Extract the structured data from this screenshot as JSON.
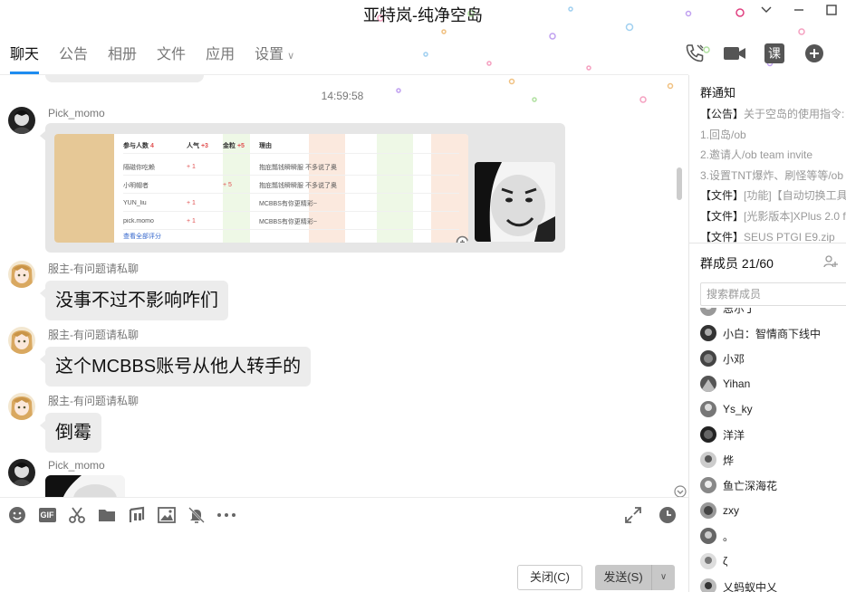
{
  "window": {
    "title": "亚特岚-纯净空岛",
    "controls": [
      "minimize-chevron",
      "minimize",
      "maximize"
    ]
  },
  "tabs": [
    {
      "label": "聊天",
      "active": true
    },
    {
      "label": "公告",
      "active": false
    },
    {
      "label": "相册",
      "active": false
    },
    {
      "label": "文件",
      "active": false
    },
    {
      "label": "应用",
      "active": false
    },
    {
      "label": "设置",
      "active": false
    }
  ],
  "header_tools": {
    "course_label": "课",
    "icons": [
      "phone-icon",
      "video-icon",
      "course-icon",
      "add-circle-icon"
    ]
  },
  "chat": {
    "timestamp": "14:59:58",
    "messages": [
      {
        "sender": "Pick_momo",
        "type": "image",
        "avatar": "dark"
      },
      {
        "sender": "服主-有问题请私聊",
        "type": "text",
        "text": "没事不过不影响咋们",
        "avatar": "anime"
      },
      {
        "sender": "服主-有问题请私聊",
        "type": "text",
        "text": "这个MCBBS账号从他人转手的",
        "avatar": "anime"
      },
      {
        "sender": "服主-有问题请私聊",
        "type": "text",
        "text": "倒霉",
        "avatar": "anime"
      },
      {
        "sender": "Pick_momo",
        "type": "image",
        "avatar": "dark"
      }
    ],
    "rating_table": {
      "headers": {
        "participants": "参与人数",
        "participants_count": "4",
        "popularity": "人气",
        "popularity_delta": "+3",
        "gold": "金粒",
        "gold_delta": "+5",
        "reason": "理由"
      },
      "rows": [
        {
          "user": "隔磁你吃赖",
          "pop": "+ 1",
          "gold": "",
          "reason": "抱庇瓢钱瞬瞬服 不多说了奥"
        },
        {
          "user": "小明帽者",
          "pop": "",
          "gold": "+ 5",
          "reason": "抱庇瓢钱瞬瞬服 不多说了奥"
        },
        {
          "user": "YUN_liu",
          "pop": "+ 1",
          "gold": "",
          "reason": "MCBBS有你更精彩~"
        },
        {
          "user": "pick.momo",
          "pop": "+ 1",
          "gold": "",
          "reason": "MCBBS有你更精彩~"
        }
      ],
      "view_all": "查看全部评分"
    }
  },
  "composer": {
    "tool_icons": [
      "emoji-icon",
      "gif-icon",
      "scissors-icon",
      "folder-icon",
      "music-icon",
      "image-icon",
      "mute-bell-icon",
      "more-icon"
    ],
    "gif_label": "GIF",
    "close_label": "关闭(C)",
    "send_label": "发送(S)"
  },
  "panel": {
    "notice_title": "群通知",
    "notices": [
      {
        "tag": "【公告】",
        "text": "关于空岛的使用指令:"
      },
      {
        "tag": "",
        "text": "1.回岛/ob"
      },
      {
        "tag": "",
        "text": "2.邀请人/ob team invite"
      },
      {
        "tag": "",
        "text": "3.设置TNT爆炸、刷怪等等/ob s"
      },
      {
        "tag": "【文件】",
        "text": "[功能]【自动切换工具."
      },
      {
        "tag": "【文件】",
        "text": "[光影版本]XPlus 2.0 fo"
      },
      {
        "tag": "【文件】",
        "text": "SEUS PTGI E9.zip"
      }
    ],
    "members_title": "群成员 21/60",
    "search_placeholder": "搜索群成员",
    "members": [
      {
        "name": "忌尔丁"
      },
      {
        "name": "小白：智情商下线中"
      },
      {
        "name": "小邓"
      },
      {
        "name": "Yihan"
      },
      {
        "name": "Ys_ky"
      },
      {
        "name": "洋洋"
      },
      {
        "name": "烨"
      },
      {
        "name": "鱼亡深海花"
      },
      {
        "name": "zxy"
      },
      {
        "name": "。"
      },
      {
        "name": "ζ"
      },
      {
        "name": "乂蚂蚁中乂"
      }
    ]
  },
  "colors": {
    "accent": "#1e8cf0",
    "bubble": "#ececec",
    "positive": "#e05050"
  }
}
